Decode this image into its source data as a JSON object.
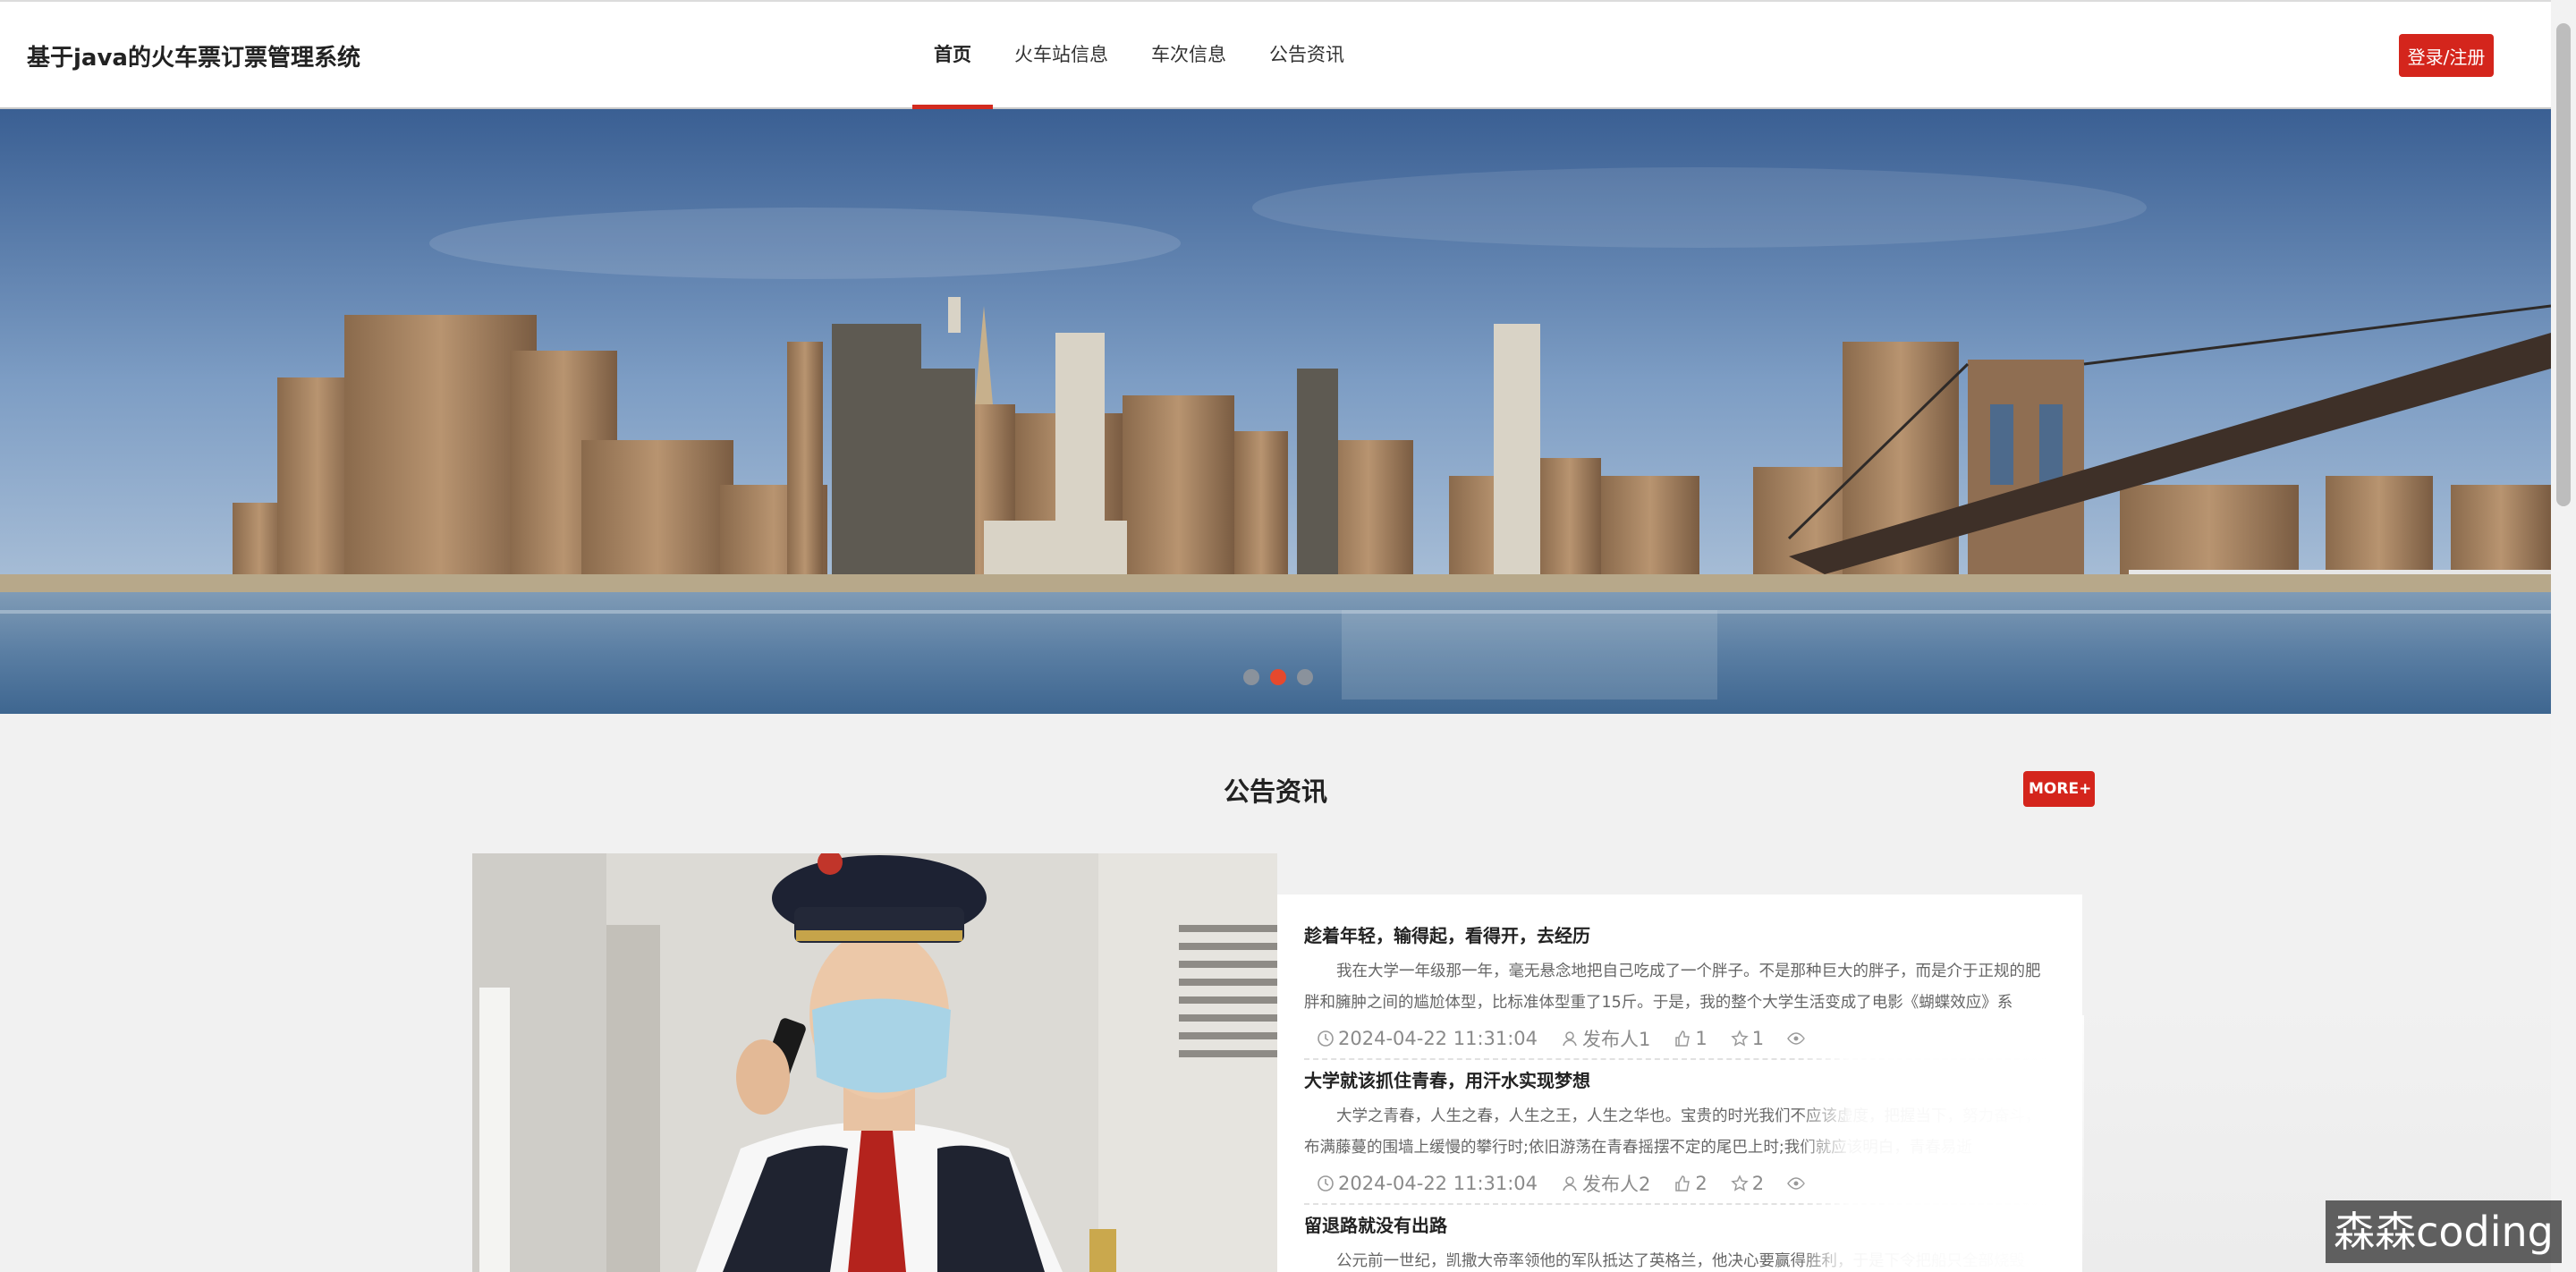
{
  "header": {
    "site_title": "基于java的火车票订票管理系统",
    "nav": [
      {
        "label": "首页",
        "active": true
      },
      {
        "label": "火车站信息",
        "active": false
      },
      {
        "label": "车次信息",
        "active": false
      },
      {
        "label": "公告资讯",
        "active": false
      }
    ],
    "login_label": "登录/注册"
  },
  "banner": {
    "slides": 3,
    "active_slide": 2
  },
  "section": {
    "title": "公告资讯",
    "more_label": "MORE+"
  },
  "news": [
    {
      "title": "趁着年轻，输得起，看得开，去经历",
      "body": "我在大学一年级那一年，毫无悬念地把自己吃成了一个胖子。不是那种巨大的胖子，而是介于正规的肥胖和臃肿之间的尴尬体型，比标准体型重了15斤。于是，我的整个大学生活变成了电影《蝴蝶效应》系",
      "date": "2024-04-22 11:31:04",
      "author": "发布人1",
      "likes": "1",
      "favs": "1"
    },
    {
      "title": "大学就该抓住青春，用汗水实现梦想",
      "body": "大学之青春，人生之春，人生之王，人生之华也。宝贵的时光我们不应该虚度，把握当下，努力奋斗，布满藤蔓的围墙上缓慢的攀行时;依旧游荡在青春摇摆不定的尾巴上时;我们就应该明白，青春易逝",
      "date": "2024-04-22 11:31:04",
      "author": "发布人2",
      "likes": "2",
      "favs": "2"
    },
    {
      "title": "留退路就没有出路",
      "body": "公元前一世纪，凯撒大帝率领他的军队抵达了英格兰，他决心要赢得胜利，于是下令把船只全部烧毁"
    }
  ],
  "watermark": "森森coding",
  "colors": {
    "accent": "#d4251c",
    "active_dot": "#e6492d"
  },
  "icons": [
    "clock-icon",
    "user-icon",
    "thumb-up-icon",
    "star-icon",
    "eye-icon"
  ]
}
